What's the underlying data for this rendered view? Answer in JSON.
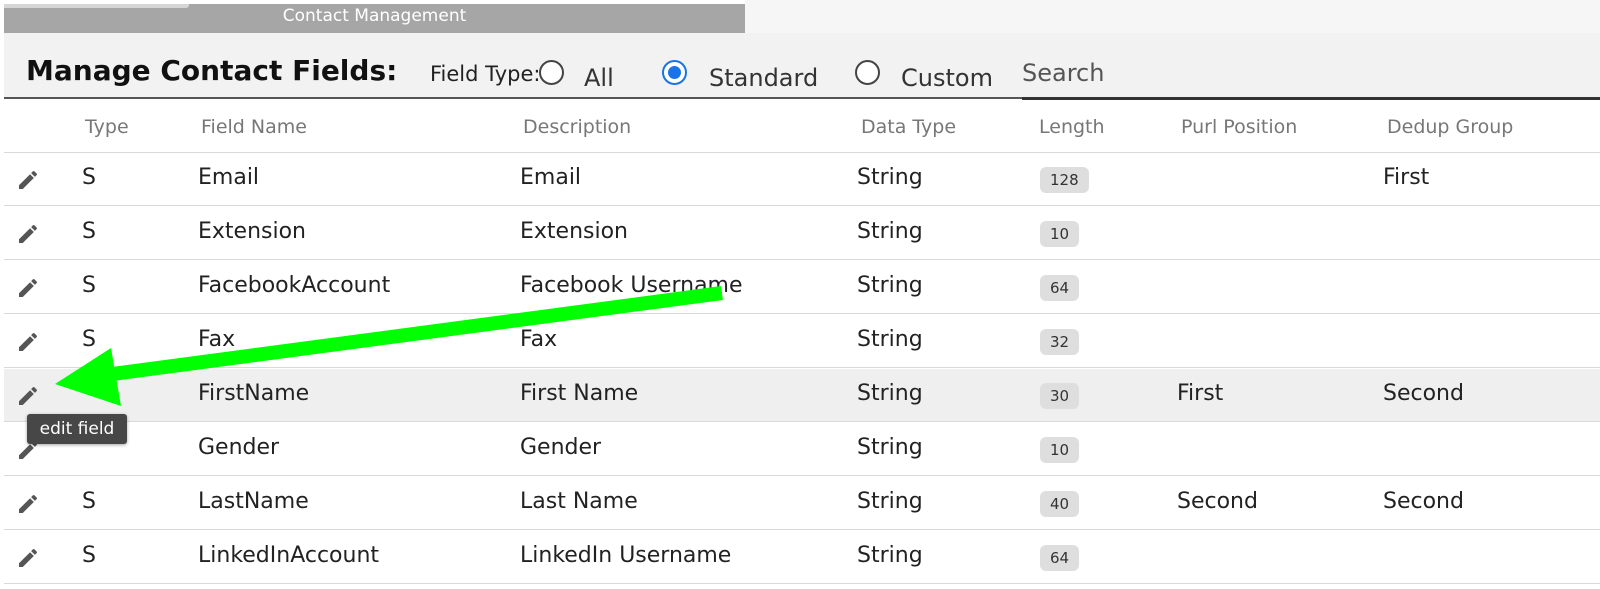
{
  "window": {
    "title": "Contact Management"
  },
  "header": {
    "title": "Manage Contact Fields:",
    "field_type_label": "Field Type:",
    "filters": [
      {
        "label": "All",
        "selected": false
      },
      {
        "label": "Standard",
        "selected": true
      },
      {
        "label": "Custom",
        "selected": false
      }
    ],
    "search_placeholder": "Search"
  },
  "table": {
    "columns": [
      "Type",
      "Field Name",
      "Description",
      "Data Type",
      "Length",
      "Purl Position",
      "Dedup Group"
    ],
    "rows": [
      {
        "type": "S",
        "field_name": "Email",
        "description": "Email",
        "data_type": "String",
        "length": "128",
        "purl_position": "",
        "dedup_group": "First"
      },
      {
        "type": "S",
        "field_name": "Extension",
        "description": "Extension",
        "data_type": "String",
        "length": "10",
        "purl_position": "",
        "dedup_group": ""
      },
      {
        "type": "S",
        "field_name": "FacebookAccount",
        "description": "Facebook Username",
        "data_type": "String",
        "length": "64",
        "purl_position": "",
        "dedup_group": ""
      },
      {
        "type": "S",
        "field_name": "Fax",
        "description": "Fax",
        "data_type": "String",
        "length": "32",
        "purl_position": "",
        "dedup_group": ""
      },
      {
        "type": "",
        "field_name": "FirstName",
        "description": "First Name",
        "data_type": "String",
        "length": "30",
        "purl_position": "First",
        "dedup_group": "Second",
        "highlighted": true
      },
      {
        "type": "",
        "field_name": "Gender",
        "description": "Gender",
        "data_type": "String",
        "length": "10",
        "purl_position": "",
        "dedup_group": ""
      },
      {
        "type": "S",
        "field_name": "LastName",
        "description": "Last Name",
        "data_type": "String",
        "length": "40",
        "purl_position": "Second",
        "dedup_group": "Second"
      },
      {
        "type": "S",
        "field_name": "LinkedInAccount",
        "description": "LinkedIn Username",
        "data_type": "String",
        "length": "64",
        "purl_position": "",
        "dedup_group": ""
      }
    ]
  },
  "tooltip": {
    "text": "edit field"
  },
  "colors": {
    "accent": "#1a73e8",
    "annotation_arrow": "#00ff00",
    "titlebar": "#a6a6a6",
    "row_highlight": "#efefef"
  },
  "icons": {
    "row_action": "pencil-icon"
  }
}
